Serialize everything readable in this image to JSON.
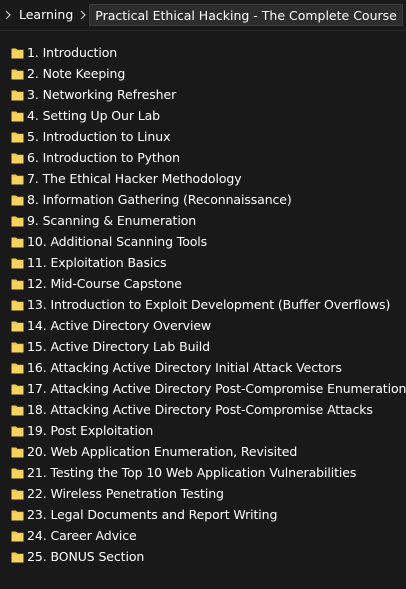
{
  "breadcrumb": {
    "items": [
      "Learning",
      "Practical Ethical Hacking - The Complete Course"
    ]
  },
  "folder_icon": "folder-icon",
  "colors": {
    "background": "#191919",
    "folder": "#F2C84B",
    "text": "#FFFFFF"
  },
  "folders": [
    "1. Introduction",
    "2. Note Keeping",
    "3. Networking Refresher",
    "4. Setting Up Our Lab",
    "5. Introduction to Linux",
    "6. Introduction to Python",
    "7. The Ethical Hacker Methodology",
    "8. Information Gathering (Reconnaissance)",
    "9. Scanning & Enumeration",
    "10. Additional Scanning Tools",
    "11. Exploitation Basics",
    "12. Mid-Course Capstone",
    "13. Introduction to Exploit Development (Buffer Overflows)",
    "14. Active Directory Overview",
    "15. Active Directory Lab Build",
    "16. Attacking Active Directory Initial Attack Vectors",
    "17. Attacking Active Directory Post-Compromise Enumeration",
    "18. Attacking Active Directory Post-Compromise Attacks",
    "19. Post Exploitation",
    "20. Web Application Enumeration, Revisited",
    "21. Testing the Top 10 Web Application Vulnerabilities",
    "22. Wireless Penetration Testing",
    "23. Legal Documents and Report Writing",
    "24. Career Advice",
    "25. BONUS Section"
  ]
}
